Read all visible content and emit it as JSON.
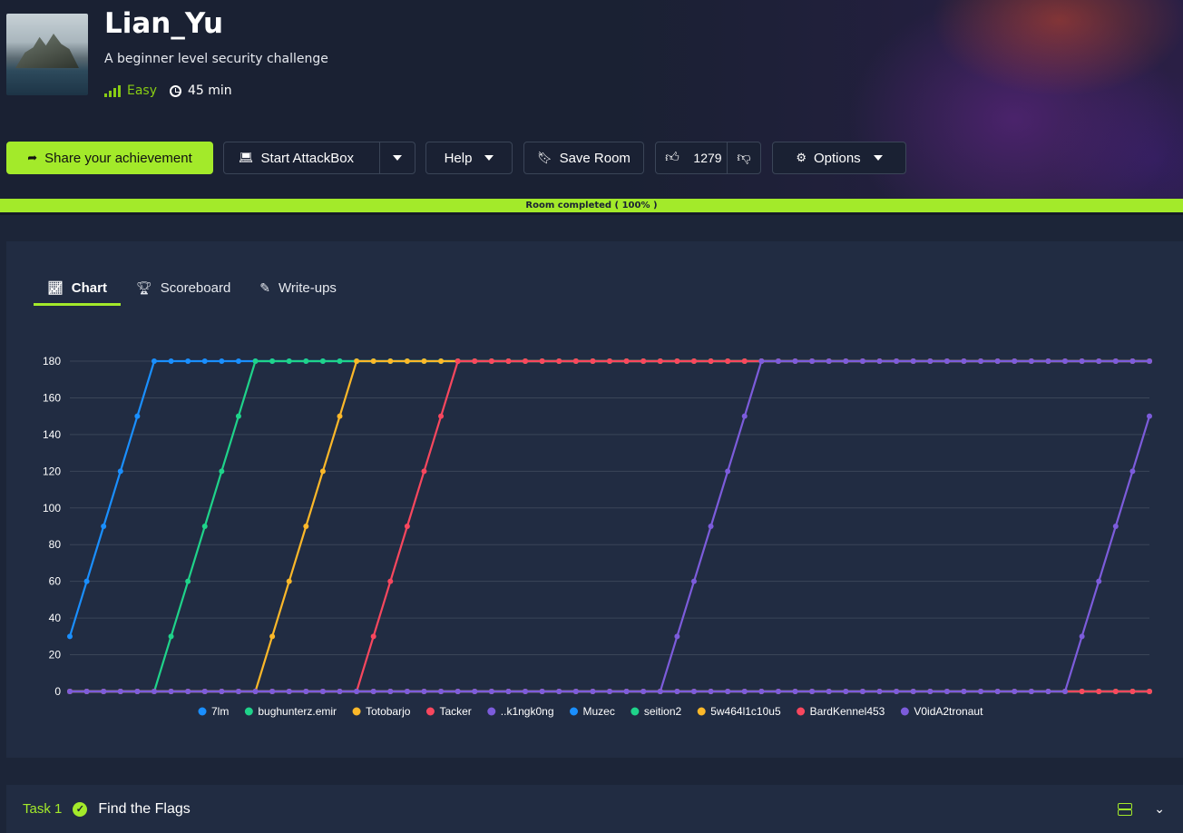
{
  "room": {
    "title": "Lian_Yu",
    "subtitle": "A beginner level security challenge",
    "difficulty": "Easy",
    "duration": "45 min"
  },
  "actions": {
    "share": "Share your achievement",
    "attackbox": "Start AttackBox",
    "help": "Help",
    "save": "Save Room",
    "votes": "1279",
    "options": "Options"
  },
  "progress": {
    "label": "Room completed ( 100% )",
    "percent": 100
  },
  "tabs": [
    {
      "label": "Chart",
      "icon": "chart-line-icon",
      "active": true
    },
    {
      "label": "Scoreboard",
      "icon": "trophy-icon",
      "active": false
    },
    {
      "label": "Write-ups",
      "icon": "pencil-icon",
      "active": false
    }
  ],
  "chart_data": {
    "type": "line",
    "title": "",
    "xlabel": "",
    "ylabel": "",
    "ylim": [
      0,
      180
    ],
    "yticks": [
      0,
      20,
      40,
      60,
      80,
      100,
      120,
      140,
      160,
      180
    ],
    "grid": true,
    "legend_position": "bottom",
    "x_count": 65,
    "series": [
      {
        "name": "7lm",
        "color": "#1a8fff",
        "values": [
          30,
          60,
          90,
          120,
          150,
          180,
          180,
          180,
          180,
          180,
          180,
          180,
          180,
          180,
          180,
          180,
          180,
          180,
          180,
          180,
          180,
          180,
          180,
          180,
          180,
          180,
          180,
          180,
          180,
          180,
          180,
          180,
          180,
          180,
          180,
          180,
          180,
          180,
          180,
          180,
          180,
          180,
          180,
          180,
          180,
          180,
          180,
          180,
          180,
          180,
          180,
          180,
          180,
          180,
          180,
          180,
          180,
          180,
          180,
          180,
          180,
          180,
          180,
          180,
          180
        ]
      },
      {
        "name": "bughunterz.emir",
        "color": "#1fd38a",
        "values": [
          0,
          0,
          0,
          0,
          0,
          0,
          30,
          60,
          90,
          120,
          150,
          180,
          180,
          180,
          180,
          180,
          180,
          180,
          180,
          180,
          180,
          180,
          180,
          180,
          180,
          180,
          180,
          180,
          180,
          180,
          180,
          180,
          180,
          180,
          180,
          180,
          180,
          180,
          180,
          180,
          180,
          180,
          180,
          180,
          180,
          180,
          180,
          180,
          180,
          180,
          180,
          180,
          180,
          180,
          180,
          180,
          180,
          180,
          180,
          180,
          180,
          180,
          180,
          180,
          180
        ]
      },
      {
        "name": "Totobarjo",
        "color": "#fcb829",
        "values": [
          0,
          0,
          0,
          0,
          0,
          0,
          0,
          0,
          0,
          0,
          0,
          0,
          30,
          60,
          90,
          120,
          150,
          180,
          180,
          180,
          180,
          180,
          180,
          180,
          180,
          180,
          180,
          180,
          180,
          180,
          180,
          180,
          180,
          180,
          180,
          180,
          180,
          180,
          180,
          180,
          180,
          180,
          180,
          180,
          180,
          180,
          180,
          180,
          180,
          180,
          180,
          180,
          180,
          180,
          180,
          180,
          180,
          180,
          180,
          180,
          180,
          180,
          180,
          180,
          180
        ]
      },
      {
        "name": "Tacker",
        "color": "#f8475e",
        "values": [
          0,
          0,
          0,
          0,
          0,
          0,
          0,
          0,
          0,
          0,
          0,
          0,
          0,
          0,
          0,
          0,
          0,
          0,
          30,
          60,
          90,
          120,
          150,
          180,
          180,
          180,
          180,
          180,
          180,
          180,
          180,
          180,
          180,
          180,
          180,
          180,
          180,
          180,
          180,
          180,
          180,
          180,
          180,
          180,
          180,
          180,
          180,
          180,
          180,
          180,
          180,
          180,
          180,
          180,
          180,
          180,
          180,
          180,
          180,
          180,
          180,
          180,
          180,
          180,
          180
        ]
      },
      {
        "name": "..k1ngk0ng",
        "color": "#7c5cdb",
        "values": [
          0,
          0,
          0,
          0,
          0,
          0,
          0,
          0,
          0,
          0,
          0,
          0,
          0,
          0,
          0,
          0,
          0,
          0,
          0,
          0,
          0,
          0,
          0,
          0,
          0,
          0,
          0,
          0,
          0,
          0,
          0,
          0,
          0,
          0,
          0,
          0,
          30,
          60,
          90,
          120,
          150,
          180,
          180,
          180,
          180,
          180,
          180,
          180,
          180,
          180,
          180,
          180,
          180,
          180,
          180,
          180,
          180,
          180,
          180,
          180,
          180,
          180,
          180,
          180,
          180
        ]
      },
      {
        "name": "Muzec",
        "color": "#1a8fff",
        "values": [
          0,
          0,
          0,
          0,
          0,
          0,
          0,
          0,
          0,
          0,
          0,
          0,
          0,
          0,
          0,
          0,
          0,
          0,
          0,
          0,
          0,
          0,
          0,
          0,
          0,
          0,
          0,
          0,
          0,
          0,
          0,
          0,
          0,
          0,
          0,
          0,
          0,
          0,
          0,
          0,
          0,
          0,
          0,
          0,
          0,
          0,
          0,
          0,
          0,
          0,
          0,
          0,
          0,
          0,
          0,
          0,
          0,
          0,
          0,
          0,
          0,
          0,
          0,
          0,
          0
        ]
      },
      {
        "name": "seition2",
        "color": "#1fd38a",
        "values": [
          0,
          0,
          0,
          0,
          0,
          0,
          0,
          0,
          0,
          0,
          0,
          0,
          0,
          0,
          0,
          0,
          0,
          0,
          0,
          0,
          0,
          0,
          0,
          0,
          0,
          0,
          0,
          0,
          0,
          0,
          0,
          0,
          0,
          0,
          0,
          0,
          0,
          0,
          0,
          0,
          0,
          0,
          0,
          0,
          0,
          0,
          0,
          0,
          0,
          0,
          0,
          0,
          0,
          0,
          0,
          0,
          0,
          0,
          0,
          0,
          0,
          0,
          0,
          0,
          0
        ]
      },
      {
        "name": "5w464l1c10u5",
        "color": "#fcb829",
        "values": [
          0,
          0,
          0,
          0,
          0,
          0,
          0,
          0,
          0,
          0,
          0,
          0,
          0,
          0,
          0,
          0,
          0,
          0,
          0,
          0,
          0,
          0,
          0,
          0,
          0,
          0,
          0,
          0,
          0,
          0,
          0,
          0,
          0,
          0,
          0,
          0,
          0,
          0,
          0,
          0,
          0,
          0,
          0,
          0,
          0,
          0,
          0,
          0,
          0,
          0,
          0,
          0,
          0,
          0,
          0,
          0,
          0,
          0,
          0,
          0,
          0,
          0,
          0,
          0,
          0
        ]
      },
      {
        "name": "BardKennel453",
        "color": "#f8475e",
        "values": [
          0,
          0,
          0,
          0,
          0,
          0,
          0,
          0,
          0,
          0,
          0,
          0,
          0,
          0,
          0,
          0,
          0,
          0,
          0,
          0,
          0,
          0,
          0,
          0,
          0,
          0,
          0,
          0,
          0,
          0,
          0,
          0,
          0,
          0,
          0,
          0,
          0,
          0,
          0,
          0,
          0,
          0,
          0,
          0,
          0,
          0,
          0,
          0,
          0,
          0,
          0,
          0,
          0,
          0,
          0,
          0,
          0,
          0,
          0,
          0,
          0,
          0,
          0,
          0,
          0
        ]
      },
      {
        "name": "V0idA2tronaut",
        "color": "#7c5cdb",
        "values": [
          0,
          0,
          0,
          0,
          0,
          0,
          0,
          0,
          0,
          0,
          0,
          0,
          0,
          0,
          0,
          0,
          0,
          0,
          0,
          0,
          0,
          0,
          0,
          0,
          0,
          0,
          0,
          0,
          0,
          0,
          0,
          0,
          0,
          0,
          0,
          0,
          0,
          0,
          0,
          0,
          0,
          0,
          0,
          0,
          0,
          0,
          0,
          0,
          0,
          0,
          0,
          0,
          0,
          0,
          0,
          0,
          0,
          0,
          0,
          0,
          30,
          60,
          90,
          120,
          150
        ]
      }
    ]
  },
  "task": {
    "number": "Task 1",
    "title": "Find the Flags",
    "completed": true
  },
  "colors": {
    "accent": "#a3ea2a",
    "background": "#1c2538",
    "panel": "#212c42"
  }
}
